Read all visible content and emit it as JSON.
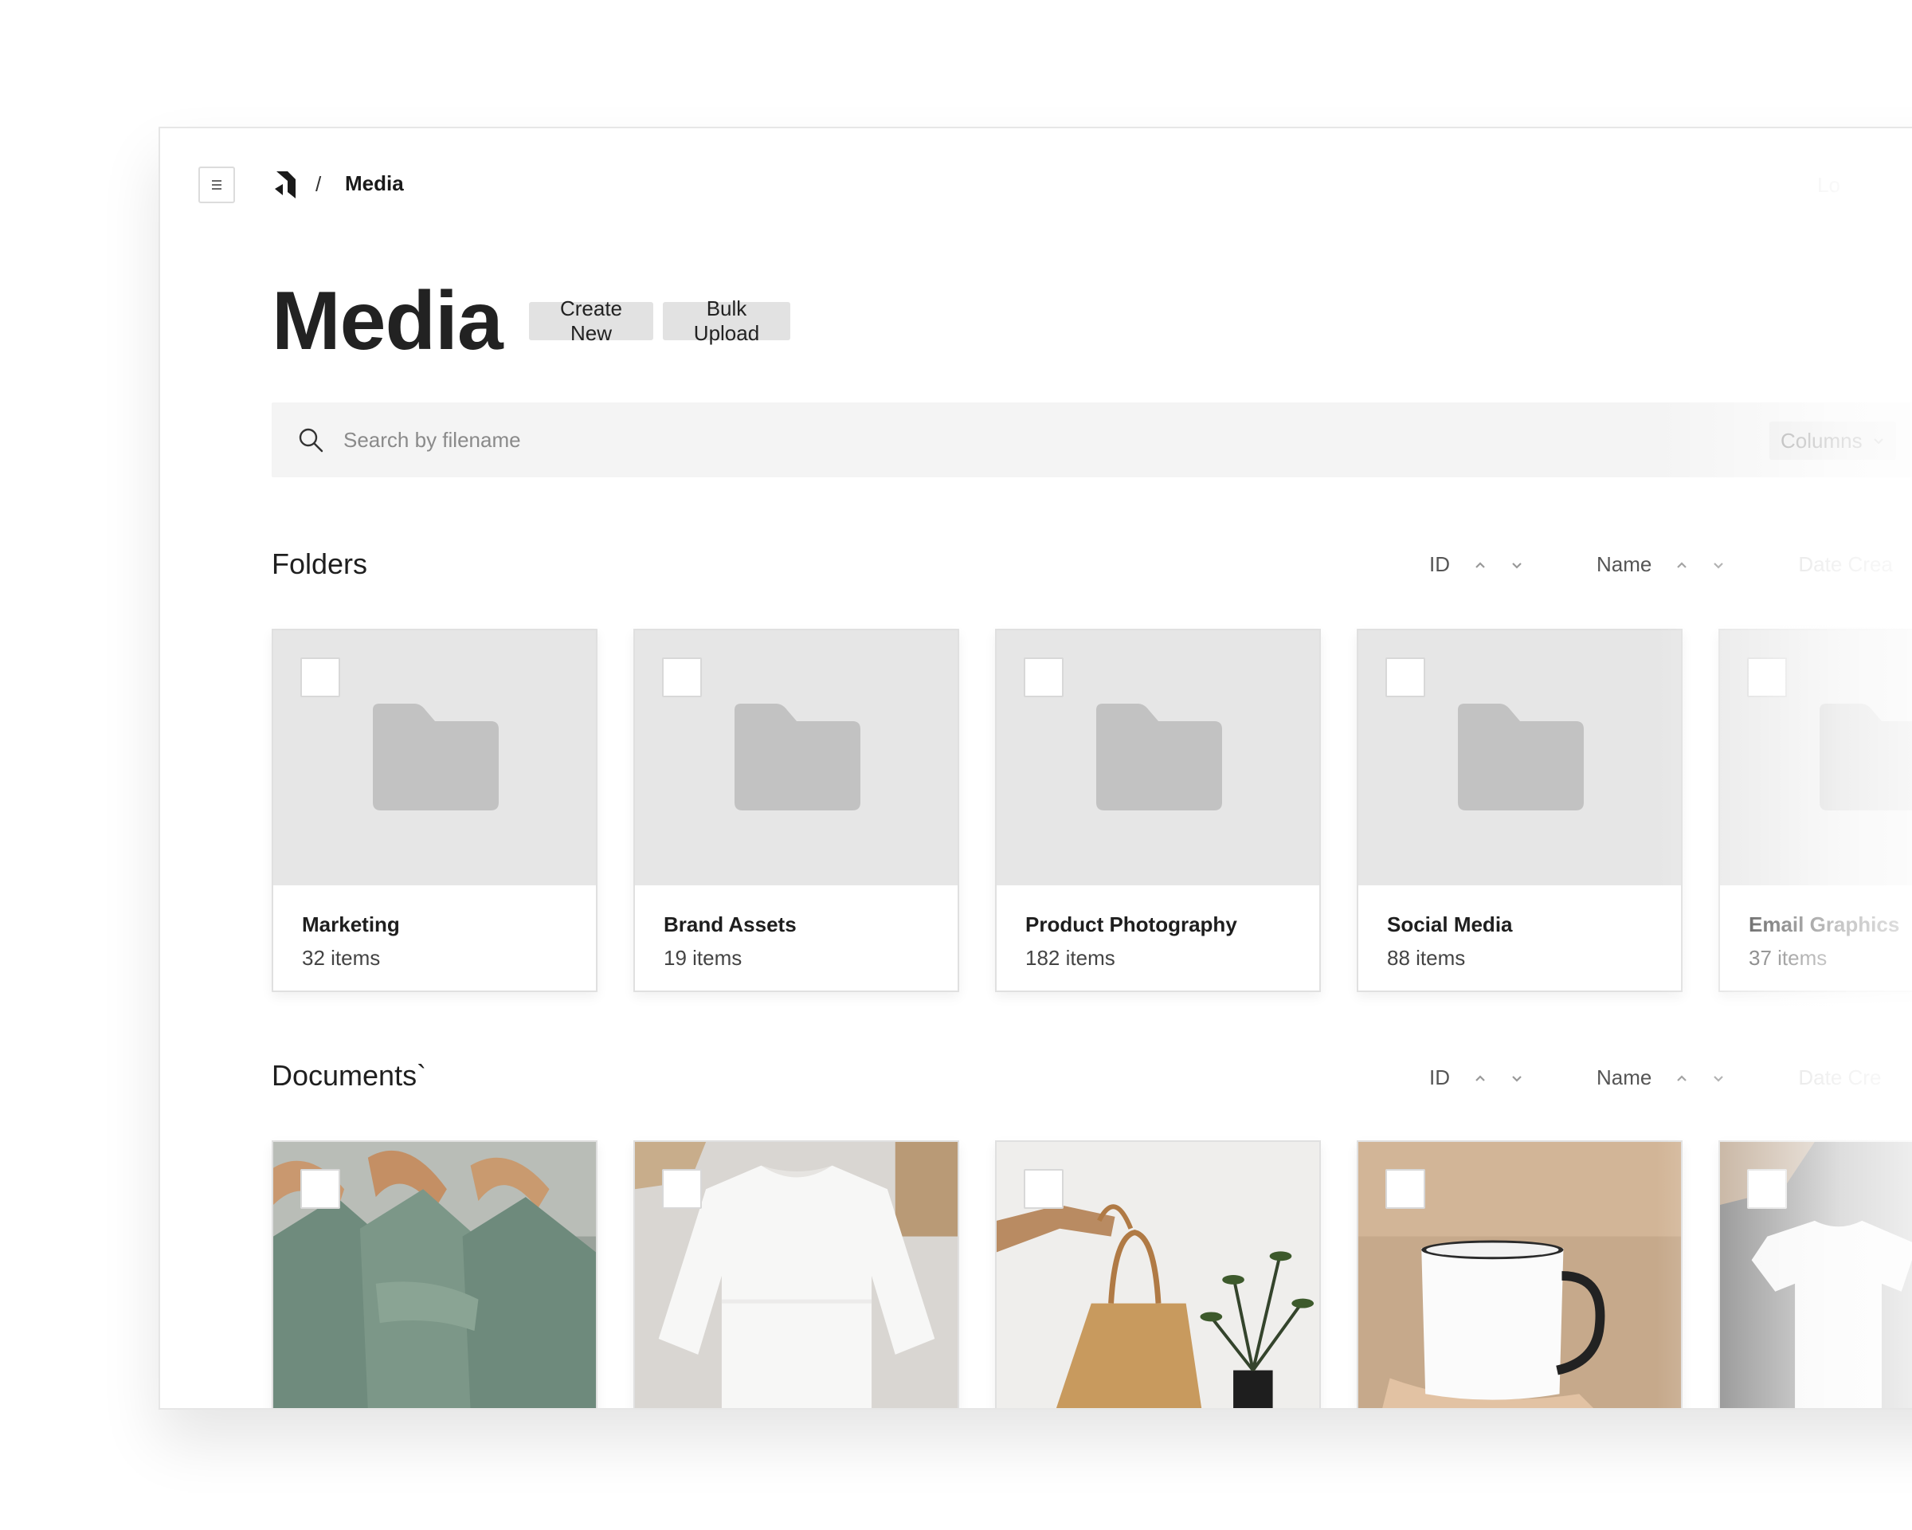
{
  "breadcrumb": {
    "separator": "/",
    "current": "Media"
  },
  "top_right_label": "Lo",
  "page": {
    "title": "Media"
  },
  "actions": {
    "create_new": "Create New",
    "bulk_upload": "Bulk Upload"
  },
  "search": {
    "placeholder": "Search by filename",
    "columns_label": "Columns"
  },
  "folders": {
    "title": "Folders",
    "sort": {
      "id": "ID",
      "name": "Name",
      "date": "Date Crea"
    },
    "items": [
      {
        "name": "Marketing",
        "count": "32 items"
      },
      {
        "name": "Brand Assets",
        "count": "19 items"
      },
      {
        "name": "Product Photography",
        "count": "182 items"
      },
      {
        "name": "Social Media",
        "count": "88 items"
      },
      {
        "name": "Email Graphics",
        "count": "37 items"
      }
    ]
  },
  "documents": {
    "title": "Documents`",
    "sort": {
      "id": "ID",
      "name": "Name",
      "date": "Date Cre"
    },
    "items": [
      {
        "subject": "green-shirts-on-hangers"
      },
      {
        "subject": "white-sweatshirt"
      },
      {
        "subject": "canvas-tote-bag"
      },
      {
        "subject": "white-enamel-mug"
      },
      {
        "subject": "white-t-shirt"
      }
    ]
  },
  "colors": {
    "folder_thumb_bg": "#e6e6e6",
    "folder_icon": "#c2c2c2",
    "button_bg": "#e2e2e2",
    "search_bg": "#f4f4f4"
  }
}
